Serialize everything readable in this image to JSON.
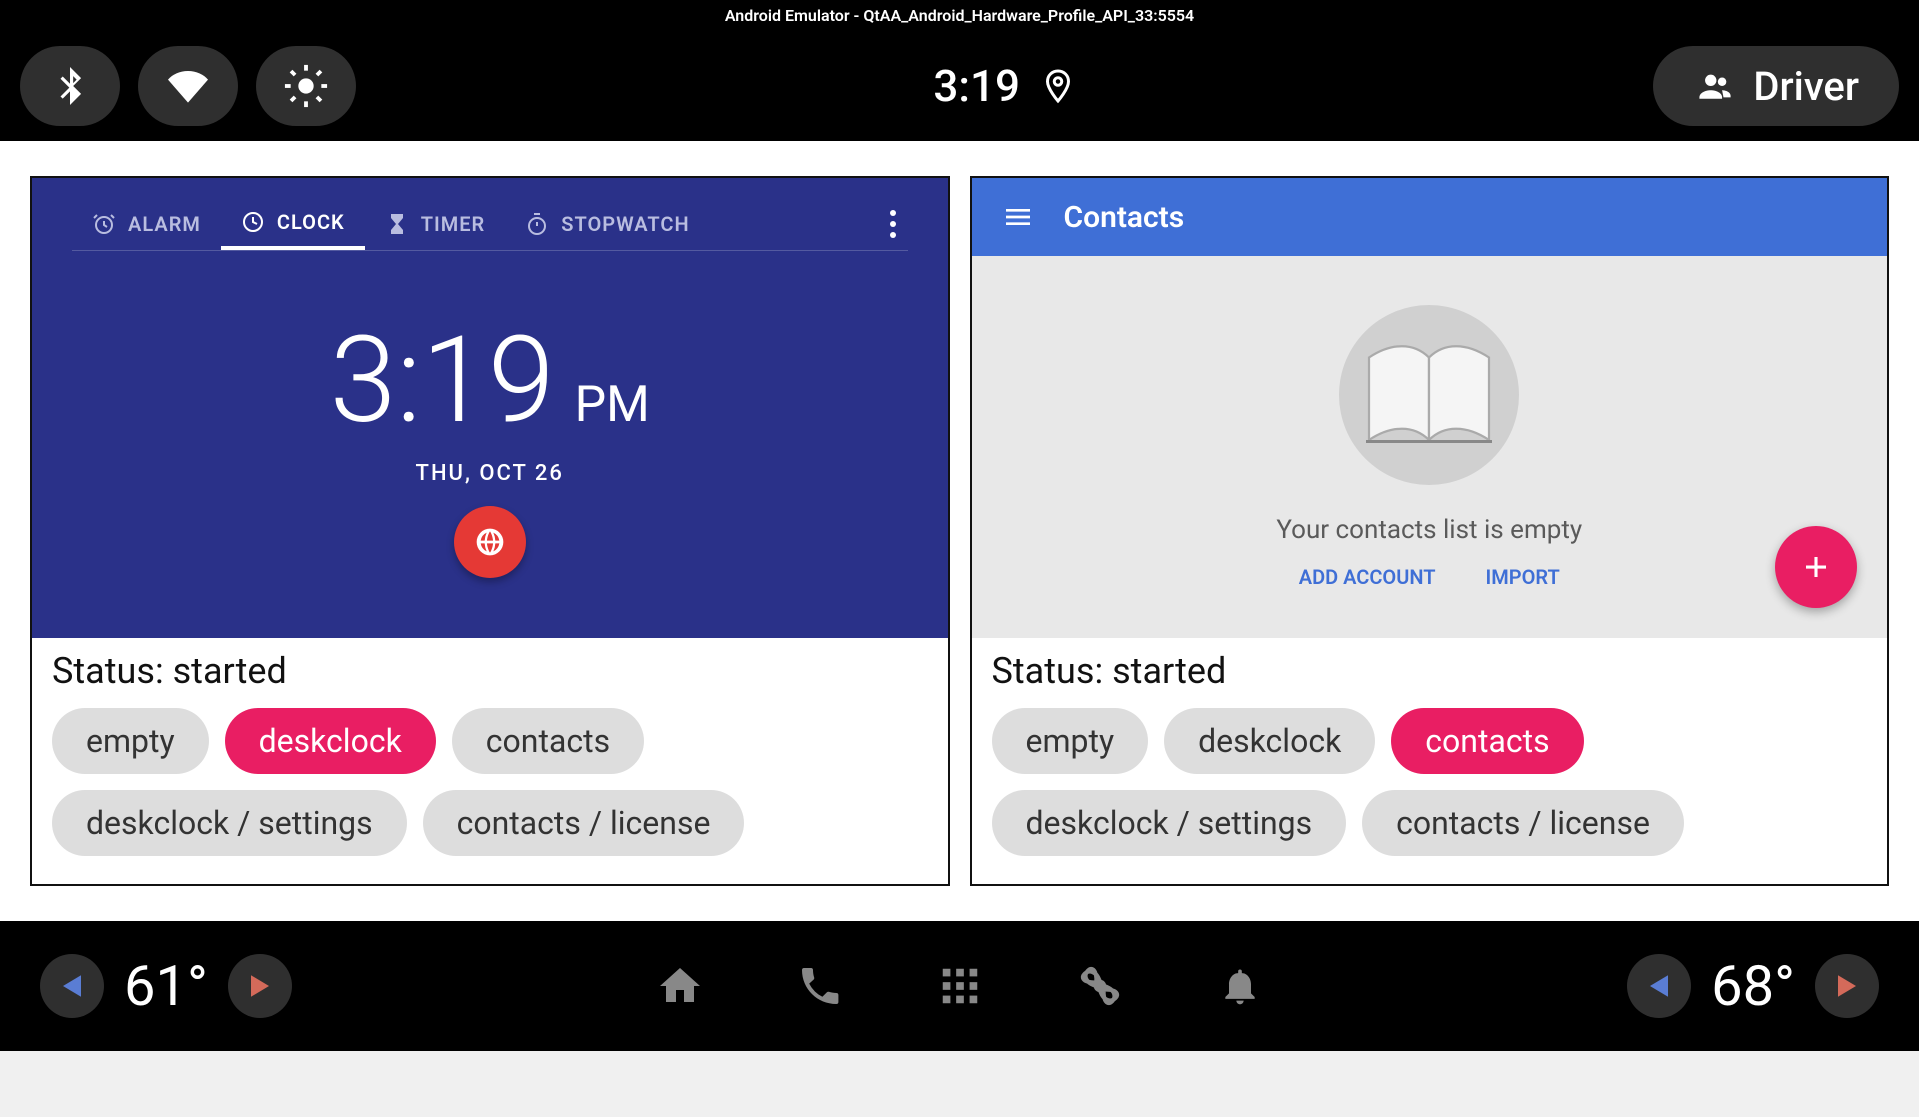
{
  "window_title": "Android Emulator - QtAA_Android_Hardware_Profile_API_33:5554",
  "status_bar": {
    "time": "3:19"
  },
  "driver_label": "Driver",
  "clock": {
    "tabs": {
      "alarm": "ALARM",
      "clock": "CLOCK",
      "timer": "TIMER",
      "stopwatch": "STOPWATCH"
    },
    "time": "3:19",
    "period": "PM",
    "date": "THU, OCT 26"
  },
  "contacts": {
    "title": "Contacts",
    "empty_text": "Your contacts list is empty",
    "add_account": "ADD ACCOUNT",
    "import": "IMPORT"
  },
  "panel_left": {
    "status": "Status: started",
    "chips": {
      "empty": "empty",
      "deskclock": "deskclock",
      "contacts": "contacts",
      "settings": "deskclock / settings",
      "license": "contacts / license"
    }
  },
  "panel_right": {
    "status": "Status: started",
    "chips": {
      "empty": "empty",
      "deskclock": "deskclock",
      "contacts": "contacts",
      "settings": "deskclock / settings",
      "license": "contacts / license"
    }
  },
  "bottom": {
    "left_temp": "61°",
    "right_temp": "68°"
  }
}
